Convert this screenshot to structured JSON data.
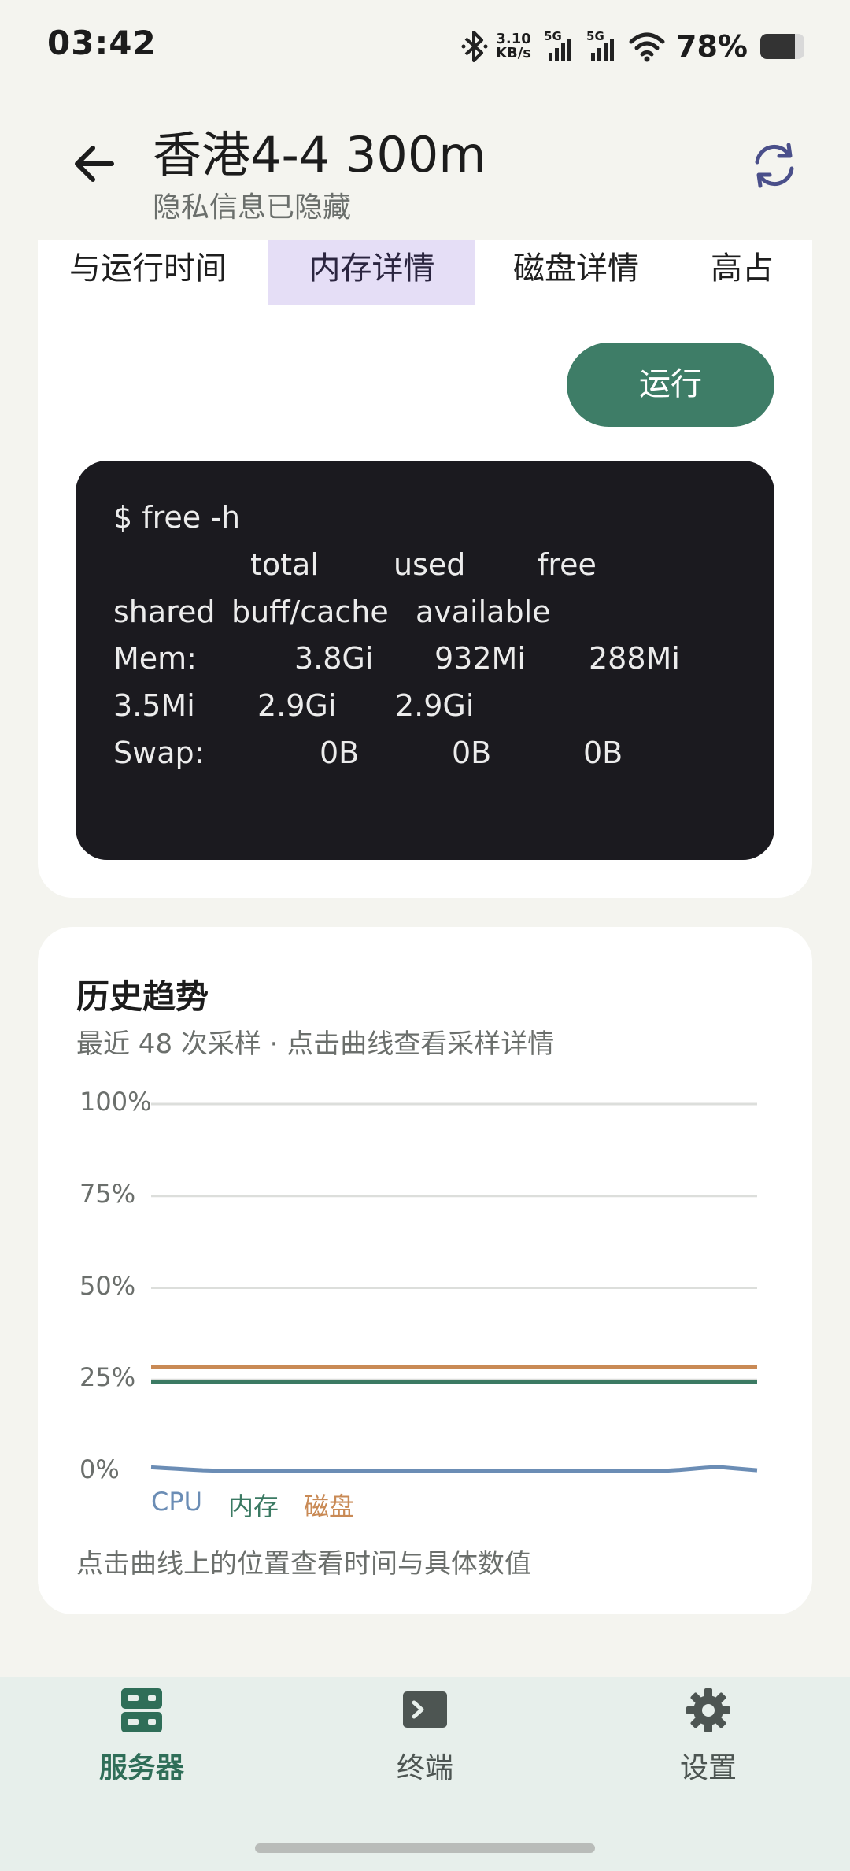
{
  "status_bar": {
    "time": "03:42",
    "speed_value": "3.10",
    "speed_unit": "KB/s",
    "signal1_label": "5G",
    "signal2_label": "5G",
    "battery_percent": "78%",
    "battery_level": 0.78,
    "icons": [
      "bluetooth-icon",
      "signal-icon",
      "signal-icon",
      "wifi-icon",
      "battery-icon"
    ]
  },
  "header": {
    "title": "香港4-4 300m",
    "subtitle": "隐私信息已隐藏",
    "back_icon": "arrow-left-icon",
    "sync_icon": "sync-icon"
  },
  "tabs": [
    {
      "label": "与运行时间",
      "active": false
    },
    {
      "label": "内存详情",
      "active": true
    },
    {
      "label": "磁盘详情",
      "active": false
    },
    {
      "label": "高占",
      "active": false
    }
  ],
  "run_button": {
    "label": "运行"
  },
  "terminal": {
    "command": "$ free -h",
    "header_row1": [
      "total",
      "used",
      "free"
    ],
    "header_row2": [
      "shared",
      "buff/cache",
      "available"
    ],
    "mem_label": "Mem:",
    "mem_row1": [
      "3.8Gi",
      "932Mi",
      "288Mi"
    ],
    "mem_row2": [
      "3.5Mi",
      "2.9Gi",
      "2.9Gi"
    ],
    "swap_label": "Swap:",
    "swap_row": [
      "0B",
      "0B",
      "0B"
    ]
  },
  "history": {
    "title": "历史趋势",
    "subtitle": "最近 48 次采样 · 点击曲线查看采样详情",
    "hint": "点击曲线上的位置查看时间与具体数值"
  },
  "chart_data": {
    "type": "line",
    "x_count": 48,
    "ylim": [
      0,
      100
    ],
    "y_ticks": [
      "100%",
      "75%",
      "50%",
      "25%",
      "0%"
    ],
    "y_tick_values": [
      100,
      75,
      50,
      25,
      0
    ],
    "grid": true,
    "legend_placement": "bottom-left",
    "series": [
      {
        "name": "CPU",
        "color": "#6b8db5",
        "values": [
          1.2,
          1.0,
          0.8,
          0.6,
          0.4,
          0.3,
          0.3,
          0.3,
          0.3,
          0.3,
          0.3,
          0.3,
          0.3,
          0.3,
          0.3,
          0.3,
          0.3,
          0.3,
          0.3,
          0.3,
          0.3,
          0.3,
          0.3,
          0.3,
          0.3,
          0.3,
          0.3,
          0.3,
          0.3,
          0.3,
          0.3,
          0.3,
          0.3,
          0.3,
          0.3,
          0.3,
          0.3,
          0.3,
          0.3,
          0.3,
          0.3,
          0.5,
          0.8,
          1.1,
          1.3,
          1.0,
          0.7,
          0.4
        ]
      },
      {
        "name": "内存",
        "color": "#3b7a63",
        "values": [
          24.5,
          24.5,
          24.5,
          24.5,
          24.5,
          24.5,
          24.5,
          24.5,
          24.5,
          24.5,
          24.5,
          24.5,
          24.5,
          24.5,
          24.5,
          24.5,
          24.5,
          24.5,
          24.5,
          24.5,
          24.5,
          24.5,
          24.5,
          24.5,
          24.5,
          24.5,
          24.5,
          24.5,
          24.5,
          24.5,
          24.5,
          24.5,
          24.5,
          24.5,
          24.5,
          24.5,
          24.5,
          24.5,
          24.5,
          24.5,
          24.5,
          24.5,
          24.5,
          24.5,
          24.5,
          24.5,
          24.5,
          24.5
        ]
      },
      {
        "name": "磁盘",
        "color": "#c98a55",
        "values": [
          28.5,
          28.5,
          28.5,
          28.5,
          28.5,
          28.5,
          28.5,
          28.5,
          28.5,
          28.5,
          28.5,
          28.5,
          28.5,
          28.5,
          28.5,
          28.5,
          28.5,
          28.5,
          28.5,
          28.5,
          28.5,
          28.5,
          28.5,
          28.5,
          28.5,
          28.5,
          28.5,
          28.5,
          28.5,
          28.5,
          28.5,
          28.5,
          28.5,
          28.5,
          28.5,
          28.5,
          28.5,
          28.5,
          28.5,
          28.5,
          28.5,
          28.5,
          28.5,
          28.5,
          28.5,
          28.5,
          28.5,
          28.5
        ]
      }
    ]
  },
  "bottom_nav": [
    {
      "label": "服务器",
      "icon": "server-icon",
      "active": true
    },
    {
      "label": "终端",
      "icon": "terminal-icon",
      "active": false
    },
    {
      "label": "设置",
      "icon": "gear-icon",
      "active": false
    }
  ]
}
